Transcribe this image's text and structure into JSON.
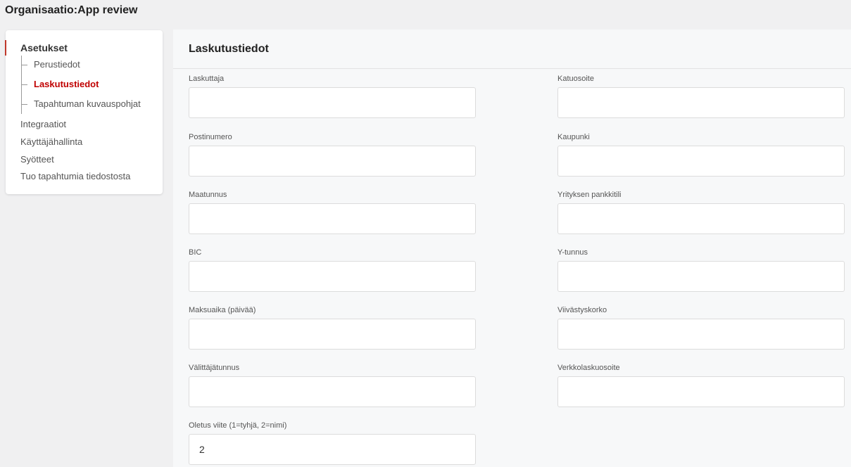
{
  "header": {
    "title": "Organisaatio:App review"
  },
  "sidebar": {
    "section_title": "Asetukset",
    "sub_items": [
      {
        "label": "Perustiedot",
        "active": false
      },
      {
        "label": "Laskutustiedot",
        "active": true
      },
      {
        "label": "Tapahtuman kuvauspohjat",
        "active": false
      }
    ],
    "items": [
      {
        "label": "Integraatiot"
      },
      {
        "label": "Käyttäjähallinta"
      },
      {
        "label": "Syötteet"
      },
      {
        "label": "Tuo tapahtumia tiedostosta"
      }
    ]
  },
  "main": {
    "title": "Laskutustiedot",
    "fields": [
      {
        "label": "Laskuttaja",
        "value": ""
      },
      {
        "label": "Katuosoite",
        "value": ""
      },
      {
        "label": "Postinumero",
        "value": ""
      },
      {
        "label": "Kaupunki",
        "value": ""
      },
      {
        "label": "Maatunnus",
        "value": ""
      },
      {
        "label": "Yrityksen pankkitili",
        "value": ""
      },
      {
        "label": "BIC",
        "value": ""
      },
      {
        "label": "Y-tunnus",
        "value": ""
      },
      {
        "label": "Maksuaika (päivää)",
        "value": ""
      },
      {
        "label": "Viivästyskorko",
        "value": ""
      },
      {
        "label": "Välittäjätunnus",
        "value": ""
      },
      {
        "label": "Verkkolaskuosoite",
        "value": ""
      },
      {
        "label": "Oletus viite (1=tyhjä, 2=nimi)",
        "value": "2"
      }
    ]
  },
  "colors": {
    "accent": "#c00000",
    "background": "#f0f0f1",
    "panel": "#f7f8f9"
  }
}
